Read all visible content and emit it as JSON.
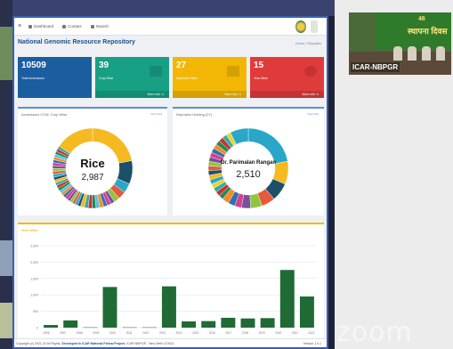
{
  "navbar": {
    "menu_icon": "hamburger-icon",
    "links": [
      {
        "label": "Dashboard",
        "icon": "desktop-icon"
      },
      {
        "label": "Contact",
        "icon": "person-icon"
      },
      {
        "label": "Search",
        "icon": "search-icon"
      }
    ]
  },
  "page": {
    "title": "National Genomic Resource Repository",
    "breadcrumb_home": "Home",
    "breadcrumb_sep": "/",
    "breadcrumb_current": "Exporter"
  },
  "cards": [
    {
      "value": "10509",
      "label": "Total Accessions",
      "more": "",
      "color": "#1a5ea0"
    },
    {
      "value": "39",
      "label": "Crop Wise",
      "more": "More info",
      "color": "#17a084"
    },
    {
      "value": "27",
      "label": "Depositor Wise",
      "more": "More info",
      "color": "#f2b705"
    },
    {
      "value": "15",
      "label": "Year Wise",
      "more": "More info",
      "color": "#e03b3b"
    }
  ],
  "crop_panel": {
    "title": "Accessions CCM: Crop Wise",
    "link": "View Grid",
    "center_label": "Rice",
    "center_value": "2,987"
  },
  "depositor_panel": {
    "title": "Depositor Holding (27)",
    "link": "View Grid",
    "center_label": "Dr. Parimalan Rangan",
    "center_value": "2,510"
  },
  "year_panel": {
    "title": "Year Wise"
  },
  "chart_data": {
    "type": "bar",
    "categories": [
      "2006",
      "2007",
      "2008",
      "2009",
      "2010",
      "2011",
      "2012",
      "2013",
      "2014",
      "2015",
      "2016",
      "2017",
      "2018"
    ],
    "x_tick_labels": [
      "2006",
      "2007",
      "2008",
      "2009",
      "2010",
      "2011",
      "2012",
      "2013",
      "2014",
      "2015",
      "2016",
      "2017",
      "2018",
      "2019",
      "2020",
      "2021",
      "2022"
    ],
    "values": [
      80,
      220,
      10,
      1240,
      10,
      10,
      1260,
      190,
      200,
      300,
      280,
      290,
      1760,
      950
    ],
    "y_ticks": [
      "0",
      "500",
      "1,000",
      "1,500",
      "2,000",
      "2,500"
    ],
    "ylim": [
      0,
      2500
    ],
    "bar_color": "#1f6a35",
    "grid": true
  },
  "footer": {
    "copyright": "Copyright (c) 2021-22 All Rights",
    "developed": "Developed In ICAR National Fellow Project",
    "org": ", ICAR-NBPGR , New Delhi 110012.",
    "version": "Version 1.0.1"
  },
  "video": {
    "participant_label": "ICAR-NBPGR",
    "banner_top": "46",
    "banner_main": "स्थापना दिवस"
  },
  "zoom_watermark": "zoom"
}
